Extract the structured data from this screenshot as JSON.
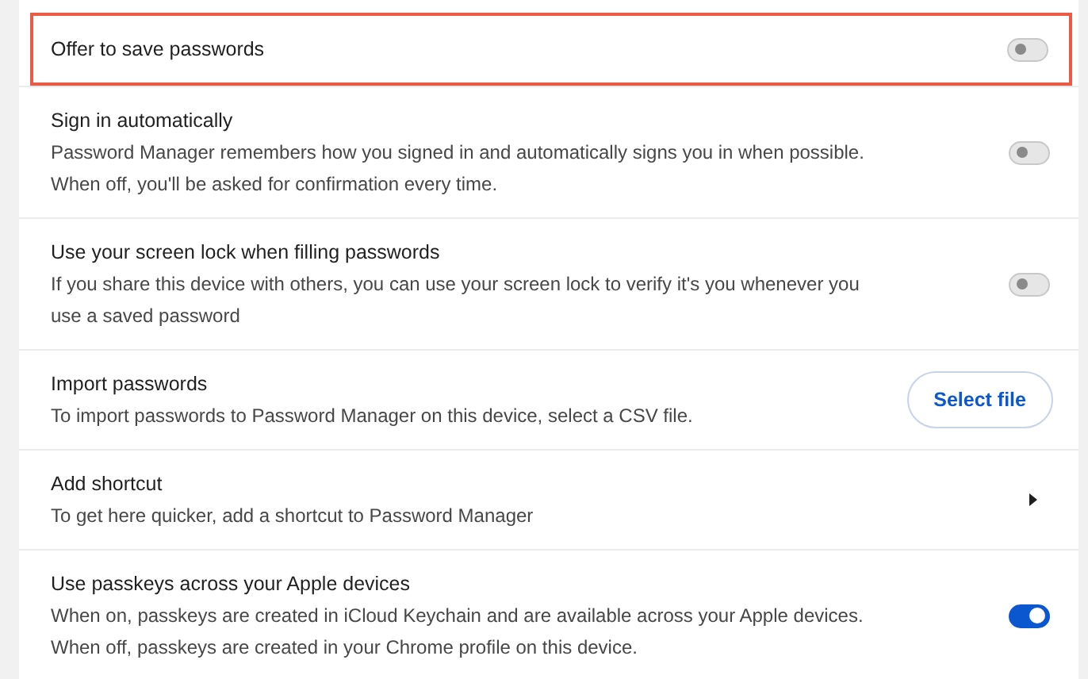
{
  "settings": [
    {
      "kind": "toggle",
      "title": "Offer to save passwords",
      "highlighted": true,
      "on": false
    },
    {
      "kind": "toggle",
      "title": "Sign in automatically",
      "description": [
        "Password Manager remembers how you signed in and automatically signs you in when possible.",
        "When off, you'll be asked for confirmation every time."
      ],
      "highlighted": false,
      "on": false
    },
    {
      "kind": "toggle",
      "title": "Use your screen lock when filling passwords",
      "description": [
        "If you share this device with others, you can use your screen lock to verify it's you whenever you",
        "use a saved password"
      ],
      "highlighted": false,
      "on": false
    },
    {
      "kind": "button",
      "title": "Import passwords",
      "description": [
        "To import passwords to Password Manager on this device, select a CSV file."
      ],
      "highlighted": false,
      "button": "Select file"
    },
    {
      "kind": "link",
      "title": "Add shortcut",
      "description": [
        "To get here quicker, add a shortcut to Password Manager"
      ],
      "highlighted": false
    },
    {
      "kind": "toggle",
      "title": "Use passkeys across your Apple devices",
      "description": [
        "When on, passkeys are created in iCloud Keychain and are available across your Apple devices.",
        "When off, passkeys are created in your Chrome profile on this device."
      ],
      "highlighted": false,
      "on": true
    }
  ]
}
